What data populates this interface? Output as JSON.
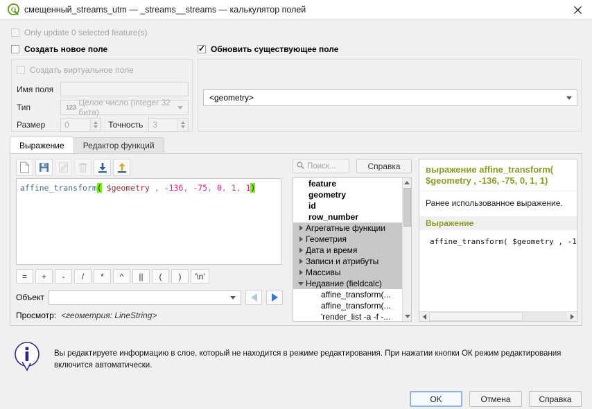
{
  "window": {
    "title": "смещенный_streams_utm — _streams__streams — калькулятор полей",
    "logo_icon": "qgis-logo-icon",
    "close_icon": "close-icon"
  },
  "options": {
    "only_update_label": "Only update 0 selected feature(s)",
    "only_update_checked": false,
    "only_update_enabled": false,
    "create_new_field_label": "Создать новое поле",
    "create_new_field_checked": false,
    "update_existing_field_label": "Обновить существующее поле",
    "update_existing_field_checked": true
  },
  "new_field": {
    "virtual_label": "Создать виртуальное поле",
    "virtual_checked": false,
    "name_label": "Имя поля",
    "name_value": "",
    "type_label": "Тип",
    "type_badge": "123",
    "type_value": "Целое число (integer 32 бита)",
    "size_label": "Размер",
    "size_value": "0",
    "precision_label": "Точность",
    "precision_value": "3"
  },
  "existing_field": {
    "selected": "<geometry>"
  },
  "tabs": [
    {
      "label": "Выражение",
      "active": true
    },
    {
      "label": "Редактор функций",
      "active": false
    }
  ],
  "expression_toolbar": [
    {
      "name": "new-expression-file-icon",
      "enabled": true
    },
    {
      "name": "save-expression-icon",
      "enabled": true
    },
    {
      "name": "edit-expression-icon",
      "enabled": false
    },
    {
      "name": "delete-expression-icon",
      "enabled": false
    },
    {
      "name": "import-expressions-icon",
      "enabled": true
    },
    {
      "name": "export-expressions-icon",
      "enabled": true
    }
  ],
  "expression": {
    "tokens": [
      {
        "text": "affine_transform",
        "kind": "fn"
      },
      {
        "text": "(",
        "kind": "hl"
      },
      {
        "text": "  ",
        "kind": "pn"
      },
      {
        "text": "$geometry",
        "kind": "var"
      },
      {
        "text": " , ",
        "kind": "pn"
      },
      {
        "text": "-136",
        "kind": "num"
      },
      {
        "text": ", ",
        "kind": "pn"
      },
      {
        "text": "-75",
        "kind": "num"
      },
      {
        "text": ", ",
        "kind": "pn"
      },
      {
        "text": "0",
        "kind": "num"
      },
      {
        "text": ", ",
        "kind": "pn"
      },
      {
        "text": "1",
        "kind": "num"
      },
      {
        "text": ", ",
        "kind": "pn"
      },
      {
        "text": "1",
        "kind": "num"
      },
      {
        "text": ")",
        "kind": "hl"
      }
    ],
    "plain": "affine_transform(  $geometry , -136, -75, 0, 1, 1)"
  },
  "operators": [
    "=",
    "+",
    "-",
    "/",
    "*",
    "^",
    "||",
    "(",
    ")",
    "'\\n'"
  ],
  "feature": {
    "label": "Объект",
    "value": "",
    "prev_icon": "previous-feature-icon",
    "next_icon": "next-feature-icon"
  },
  "preview": {
    "label": "Просмотр:",
    "value": "<геометрия: LineString>"
  },
  "functions_panel": {
    "search_placeholder": "Поиск...",
    "search_icon": "search-icon",
    "help_button": "Справка",
    "tree": [
      {
        "label": "feature",
        "type": "var",
        "indent": 1
      },
      {
        "label": "geometry",
        "type": "var",
        "indent": 1
      },
      {
        "label": "id",
        "type": "var",
        "indent": 1
      },
      {
        "label": "row_number",
        "type": "var",
        "indent": 1
      },
      {
        "label": "Агрегатные функции",
        "type": "group",
        "expanded": false
      },
      {
        "label": "Геометрия",
        "type": "group",
        "expanded": false
      },
      {
        "label": "Дата и время",
        "type": "group",
        "expanded": false
      },
      {
        "label": "Записи и атрибуты",
        "type": "group",
        "expanded": false
      },
      {
        "label": "Массивы",
        "type": "group",
        "expanded": false
      },
      {
        "label": "Недавние (fieldcalc)",
        "type": "group",
        "expanded": true
      },
      {
        "label": "affine_transform(...",
        "type": "recent"
      },
      {
        "label": "affine_transform(...",
        "type": "recent"
      },
      {
        "label": "'render_list -a -f -...",
        "type": "recent"
      }
    ]
  },
  "help_panel": {
    "title": "выражение affine_transform( $geometry , -136, -75, 0, 1, 1)",
    "description": "Ранее использованное выражение.",
    "section_heading": "Выражение",
    "code": "affine_transform(  $geometry , -1"
  },
  "info": {
    "icon": "info-icon",
    "message": "Вы редактируете информацию в слое, который не находится в режиме редактирования. При нажатии кнопки ОК режим редактирования включится автоматически."
  },
  "buttons": {
    "ok": "OK",
    "cancel": "Отмена",
    "help": "Справка"
  },
  "colors": {
    "accent_green": "#7cf000",
    "help_heading": "#8a9a2a",
    "number_token": "#e0218a",
    "function_token": "#4a6a8a",
    "variable_token": "#8c2f39",
    "default_button_border": "#8cb4e0"
  }
}
